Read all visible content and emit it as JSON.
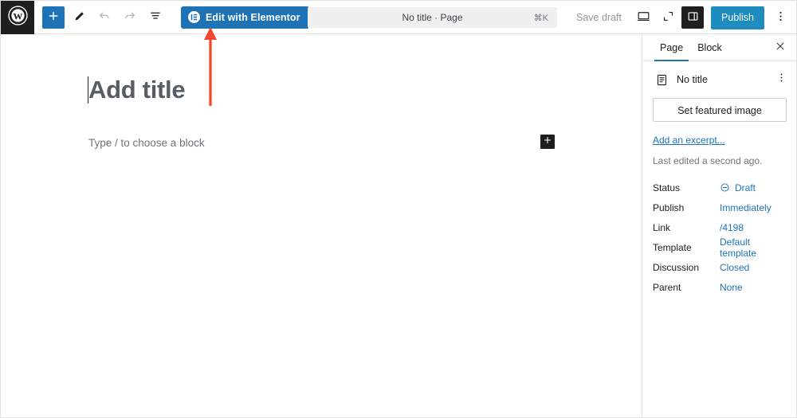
{
  "topbar": {
    "wp_logo_name": "wordpress-logo",
    "add_block_label": "+",
    "tools_icon": "pencil-icon",
    "undo_icon": "undo-icon",
    "redo_icon": "redo-icon",
    "listview_icon": "list-view-icon",
    "elementor_button_label": "Edit with Elementor",
    "command_bar_text": "No title · Page",
    "command_bar_shortcut": "⌘K",
    "save_draft_label": "Save draft",
    "preview_icon": "desktop-preview-icon",
    "fullscreen_icon": "expand-icon",
    "settings_panel_icon": "settings-sidebar-icon",
    "publish_label": "Publish",
    "options_icon": "vertical-ellipsis-icon"
  },
  "canvas": {
    "title_placeholder": "Add title",
    "block_placeholder": "Type / to choose a block",
    "inserter_label": "+"
  },
  "annotation": {
    "arrow_color": "#f4462e",
    "arrow_name": "red-annotation-arrow"
  },
  "sidebar": {
    "tabs": [
      {
        "label": "Page",
        "active": true
      },
      {
        "label": "Block",
        "active": false
      }
    ],
    "close_icon": "close-icon",
    "document": {
      "icon": "page-document-icon",
      "title": "No title",
      "menu_icon": "vertical-ellipsis-icon"
    },
    "featured_image_label": "Set featured image",
    "excerpt_link_label": "Add an excerpt...",
    "last_edited": "Last edited a second ago.",
    "meta": [
      {
        "label": "Status",
        "value": "Draft",
        "icon": "pending-circle-icon"
      },
      {
        "label": "Publish",
        "value": "Immediately",
        "icon": ""
      },
      {
        "label": "Link",
        "value": "/4198",
        "icon": ""
      },
      {
        "label": "Template",
        "value": "Default template",
        "icon": ""
      },
      {
        "label": "Discussion",
        "value": "Closed",
        "icon": ""
      },
      {
        "label": "Parent",
        "value": "None",
        "icon": ""
      }
    ]
  },
  "colors": {
    "accent_blue": "#1e72b6",
    "publish_blue": "#1e8cbe",
    "dark": "#1e1e1e",
    "annotation_red": "#f4462e"
  }
}
